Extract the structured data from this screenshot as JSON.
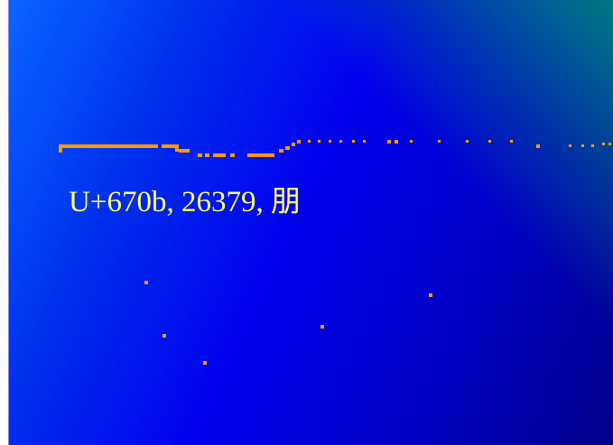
{
  "slide": {
    "caption": "U+670b, 26379, 朋",
    "colors": {
      "text": "#ffff66",
      "decoration": "#ff9900",
      "background_dark": "#00008a",
      "background_bright": "#0a66ff",
      "corner_accent": "#008080"
    }
  }
}
